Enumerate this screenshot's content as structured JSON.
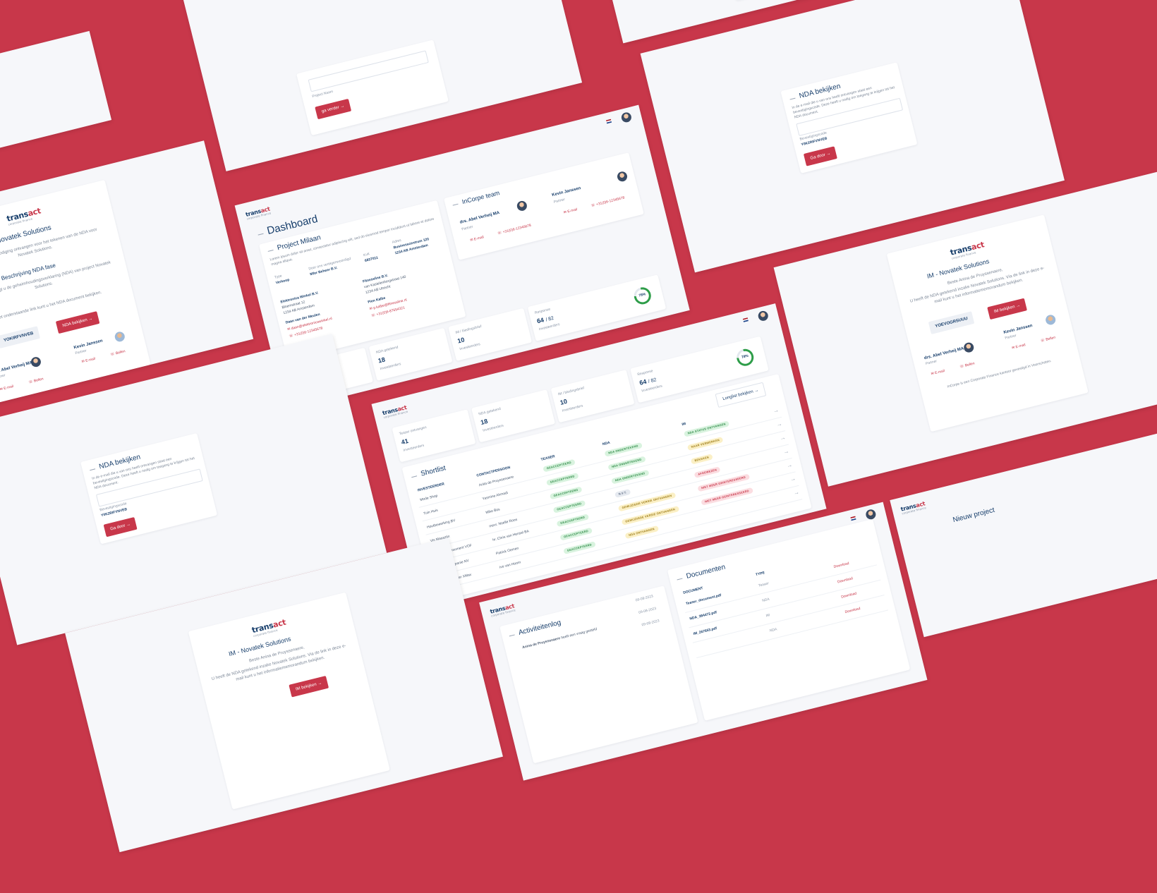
{
  "brand": {
    "name_part1": "trans",
    "name_part2": "act",
    "tagline": "corporate finance"
  },
  "colors": {
    "background": "#c8374a",
    "accent": "#c8374a",
    "navy": "#173e6b",
    "success": "#2e9d49"
  },
  "nda_screen": {
    "title": "NDA - Novatek Solutions",
    "intro": "U heeft een uitnodiging ontvangen voor het tekenen van de NDA voor Novatek Solutions.",
    "section_title": "Beschrijving NDA fase",
    "section_text": "Hierbij ontvangt u de geheimhoudingsverklaring (NDA) van project Novatek Solutions.",
    "link_text": "Met onderstaande link kunt u het NDA document bekijken.",
    "code_button": "YOKIRFVNVEB",
    "primary_button": "NDA bekijken",
    "contacts": [
      {
        "name": "drs. Abel Verheij MA",
        "role": "Partner",
        "email": "E-mail",
        "phone": "Bellen"
      },
      {
        "name": "Kevin Janssen",
        "role": "Partner",
        "email": "E-mail",
        "phone": "Bellen"
      }
    ]
  },
  "login_screen": {
    "field_label": "Project Naam",
    "button": "ga verder"
  },
  "dashboard": {
    "title": "Dashboard",
    "project_title": "Project Milaan",
    "project_desc": "Lorem ipsum dolor sit amet, consectetur adipiscing elit, sed do eiusmod tempor incididunt ut labore et dolore magna aliqua.",
    "fields": [
      {
        "label": "Type",
        "value": "Verkoop"
      },
      {
        "label": "Door ons vertegenwoordigd",
        "value": "Mfor Beheer B.V."
      },
      {
        "label": "KvK",
        "value": "6837011"
      },
      {
        "label": "Adres",
        "value": "Businesscentrum 120"
      }
    ],
    "address2": "1234 AB Amsterdam",
    "parties": [
      {
        "company": "Elektronica Winkel B.V.",
        "street": "Bloemstraat 12",
        "city": "1234 AB Amsterdam",
        "contact": "Daan van der Meulen",
        "email": "daan@elektronicawinkel.nl",
        "phone": "+31(0)6-12345678"
      },
      {
        "company": "Fitnessline B.V.",
        "street": "van Kastelenborgstraat 140",
        "city": "1234 AB Utrecht",
        "contact": "Pien Kalbe",
        "email": "p.kalbe@fitnessline.nl",
        "phone": "+31(0)6-87654321"
      }
    ],
    "team_title": "InCorpe team",
    "team": [
      {
        "name": "drs. Abel Verheij MA",
        "role": "Partner",
        "email": "E-mail",
        "phone": "+31(0)6-12345678"
      },
      {
        "name": "Kevin Janssen",
        "role": "Partner",
        "email": "E-mail",
        "phone": "+31(0)6-12345678"
      }
    ],
    "stats": [
      {
        "label": "Teaser ontvangen",
        "value": "41",
        "unit": "Investeerders"
      },
      {
        "label": "NDA getekend",
        "value": "18",
        "unit": "Investeerders"
      },
      {
        "label": "IM / biedingsbrief",
        "value": "10",
        "unit": "Investeerders"
      },
      {
        "label": "Response",
        "value": "64",
        "total": "/ 82",
        "unit": "Investeerders"
      }
    ],
    "progress_pct": 78,
    "progress_label": "78%"
  },
  "shortlist": {
    "title": "Shortlist",
    "view_all": "Longlist bekijken",
    "columns": [
      "INVESTEERDER",
      "CONTACTPERSOON",
      "TEASER",
      "NDA",
      "IM"
    ],
    "rows": [
      {
        "investor": "Mode Shop",
        "contact": "Anita de Pruyssenaere",
        "teaser": "GEACCEPTEERD",
        "nda": "NDA ONDERTEKEND",
        "im": "NDA STATUS ONTVANGEN"
      },
      {
        "investor": "Tuin Huis",
        "contact": "Yasmine Ahmadi",
        "teaser": "GEACCEPTEERD",
        "nda": "NDA ONDERTEKEND",
        "im": "NAAR VERWERKEN"
      },
      {
        "investor": "Houtbewerking BV",
        "contact": "Mike Bos",
        "teaser": "GEACCEPTEERD",
        "nda": "NDA ONDERTEKEND",
        "im": "BEKEKEN"
      },
      {
        "investor": "Vis Magazijn",
        "contact": "mevr. Noelle Roos",
        "teaser": "GEACCEPTEERD",
        "nda": "N.V.T.",
        "im": "AFGEWEZEN"
      },
      {
        "investor": "Textiele Consument VOF",
        "contact": "hr. Chris van Hensel BA",
        "teaser": "GEACCEPTEERD",
        "nda": "GEWIJZIGDE VERSIE ONTVANGEN",
        "im": "NIET MEER GEINTERESSEERD"
      },
      {
        "investor": "Gadgetcompanie NV",
        "contact": "Patrick Oemen",
        "teaser": "GEACCEPTEERD",
        "nda": "GEWIJZIGDE VERSIE ONTVANGEN",
        "im": "NIET MEER GEINTERESSEERD"
      },
      {
        "investor": "Schoenmaker XMax",
        "contact": "Ivo van Hoorn",
        "teaser": "GEACCEPTEERD",
        "nda": "NDA ONTVANGEN",
        "im": ""
      }
    ]
  },
  "nda_view": {
    "title": "NDA bekijken",
    "text": "In de e-mail die u van ons heeft ontvangen staat een bevestigingscode. Deze heeft u nodig om toegang te krijgen tot het NDA document.",
    "field_label": "Bevestigingscode",
    "field_value": "Y0K2RIFVNVEB",
    "button": "Ga door"
  },
  "im_screen": {
    "title": "IM - Novatek Solutions",
    "greeting": "Beste Anina de Pruyssenaere,",
    "text": "U heeft de NDA getekend inzake Novatek Solutions. Via de link in deze e-mail kunt u het informatiememorandum bekijken.",
    "code_button": "YOEVOGRSUUU",
    "primary_button": "IM bekijken",
    "footer": "InCorpe is een Corporate Finance kantoor gevestigd in Voorschoten.",
    "contacts": [
      {
        "name": "drs. Abel Verheij MA",
        "role": "Partner",
        "email": "E-mail",
        "phone": "Bellen"
      },
      {
        "name": "Kevin Janssen",
        "role": "Partner",
        "email": "E-mail",
        "phone": "Bellen"
      }
    ]
  },
  "activity": {
    "title": "Activiteitenlog",
    "entry": "Anina de Pruyssenaere",
    "entry_text": "heeft een vraag gesteld",
    "dates": [
      "09-08-2023",
      "09-08-2023",
      "09-08-2023"
    ]
  },
  "documents": {
    "title": "Documenten",
    "columns": [
      "DOCUMENT",
      "TYPE"
    ],
    "rows": [
      {
        "name": "Teaser_document.pdf",
        "type": "Teaser",
        "action": "Download"
      },
      {
        "name": "NDA_384472.pdf",
        "type": "NDA",
        "action": "Download"
      },
      {
        "name": "IM_267653.pdf",
        "type": "IM",
        "action": "Download"
      },
      {
        "name": "",
        "type": "NDA",
        "action": "Download"
      }
    ]
  },
  "project_screen": {
    "title": "Nieuw project"
  }
}
